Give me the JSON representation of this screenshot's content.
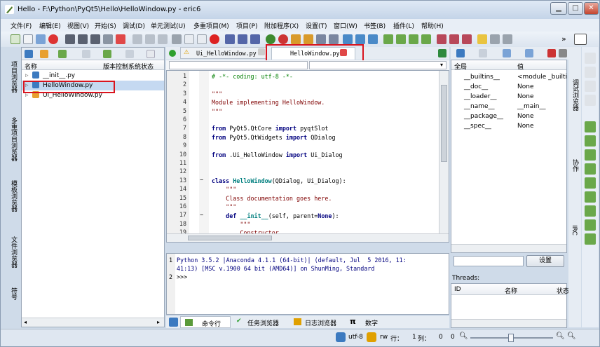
{
  "window": {
    "title": "Hello - F:\\Python\\PyQt5\\Hello\\HelloWindow.py - eric6",
    "min": "▁",
    "max": "□",
    "close": "✕"
  },
  "menu": [
    "文件(F)",
    "编辑(E)",
    "视图(V)",
    "开始(S)",
    "调试(D)",
    "单元测试(U)",
    "多重项目(M)",
    "项目(P)",
    "附加程序(X)",
    "设置(T)",
    "窗口(W)",
    "书签(B)",
    "插件(L)",
    "帮助(H)"
  ],
  "toolbar": {
    "overflow": "»"
  },
  "left_panel": {
    "col_name": "名称",
    "col_vcs": "版本控制系统状态",
    "files": [
      "__init__.py",
      "HelloWindow.py",
      "Ui_HelloWindow.py"
    ],
    "side_tabs": [
      "项目浏览器",
      "多重项目浏览器",
      "模板浏览器",
      "文件浏览器",
      "符号"
    ]
  },
  "editor": {
    "tabs": [
      "Ui_HelloWindow.py",
      "HelloWindow.py"
    ],
    "line_numbers": [
      "1",
      "2",
      "3",
      "4",
      "5",
      "6",
      "7",
      "8",
      "9",
      "10",
      "11",
      "12",
      "13",
      "14",
      "15",
      "16",
      "17",
      "18",
      "19"
    ],
    "fold_markers": {
      "13": "−",
      "17": "−"
    }
  },
  "shell": {
    "line1": "Python 3.5.2 |Anaconda 4.1.1 (64-bit)| (default, Jul  5 2016, 11:",
    "line2": "41:13) [MSC v.1900 64 bit (AMD64)] on ShunMing, Standard",
    "prompt_no1": "1",
    "prompt_no2": "2",
    "prompt": ">>>"
  },
  "bottom_tabs": [
    {
      "label": "命令行",
      "icon": "shell-icon"
    },
    {
      "label": "任务浏览器",
      "icon": "task-icon"
    },
    {
      "label": "日志浏览器",
      "icon": "log-icon"
    },
    {
      "label": "数字",
      "icon": "pi-icon"
    }
  ],
  "right_panel": {
    "col_global": "全局",
    "col_value": "值",
    "vars": [
      {
        "name": "__builtins__",
        "value": "<module _builti"
      },
      {
        "name": "__doc__",
        "value": "None"
      },
      {
        "name": "__loader__",
        "value": "None"
      },
      {
        "name": "__name__",
        "value": "__main__"
      },
      {
        "name": "__package__",
        "value": "None"
      },
      {
        "name": "__spec__",
        "value": "None"
      }
    ],
    "set_button": "设置",
    "threads_label": "Threads:",
    "th_id": "ID",
    "th_name": "名称",
    "th_state": "状态",
    "side_tabs": [
      "调试浏览器",
      "协作",
      "IRC"
    ]
  },
  "statusbar": {
    "encoding": "utf-8",
    "mode": "rw",
    "line_label": "行：",
    "line_val": "1",
    "col_label": "列：",
    "col_val": "0",
    "zoom": "0"
  },
  "colors": {
    "highlight": "#d9141e",
    "selection": "#c5d9f1",
    "accent": "#3c6ea8"
  }
}
